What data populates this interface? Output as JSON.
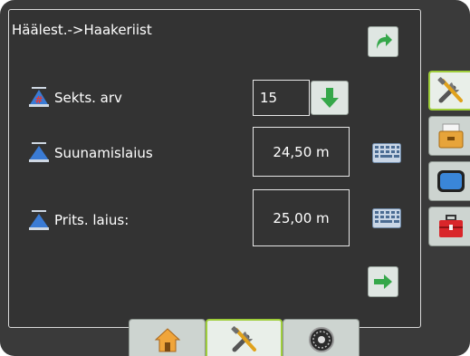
{
  "header": {
    "title": "Häälest.->Haakeriist"
  },
  "rows": [
    {
      "label": "Sekts. arv",
      "value": "15",
      "icon": "sections-triangle-icon"
    },
    {
      "label": "Suunamislaius",
      "value": "24,50 m",
      "icon": "guidance-width-triangle-icon"
    },
    {
      "label": "Prits. laius:",
      "value": "25,00 m",
      "icon": "spray-width-triangle-icon"
    }
  ],
  "colors": {
    "accent_green": "#9fce3b",
    "arrow_green": "#35a74a",
    "panel": "#333333"
  },
  "side_tabs": [
    "tools-icon",
    "storage-box-icon",
    "console-icon",
    "toolbox-icon"
  ],
  "bottom_tabs": [
    "home-icon",
    "tools-icon",
    "speedometer-icon"
  ]
}
